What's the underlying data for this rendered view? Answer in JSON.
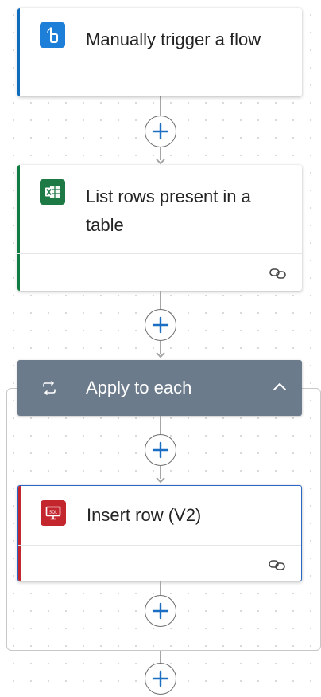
{
  "flow": {
    "trigger": {
      "title": "Manually trigger a flow",
      "icon": "touch-hand-icon",
      "accent_color": "#0f6cbd",
      "icon_bg": "#1e7fd8"
    },
    "list_rows": {
      "title": "List rows present in a table",
      "icon": "excel-icon",
      "accent_color": "#107c41",
      "icon_bg": "#1d7a45"
    },
    "apply_to_each": {
      "title": "Apply to each",
      "icon": "loop-icon",
      "header_color": "#6b7b8c",
      "chevron": "chevron-up-icon"
    },
    "insert_row": {
      "title": "Insert row (V2)",
      "icon": "sql-server-icon",
      "accent_color": "#c4262e",
      "icon_bg": "#c4262e",
      "selected_border": "#2b66c9"
    },
    "add_step_icon": "plus-icon"
  }
}
